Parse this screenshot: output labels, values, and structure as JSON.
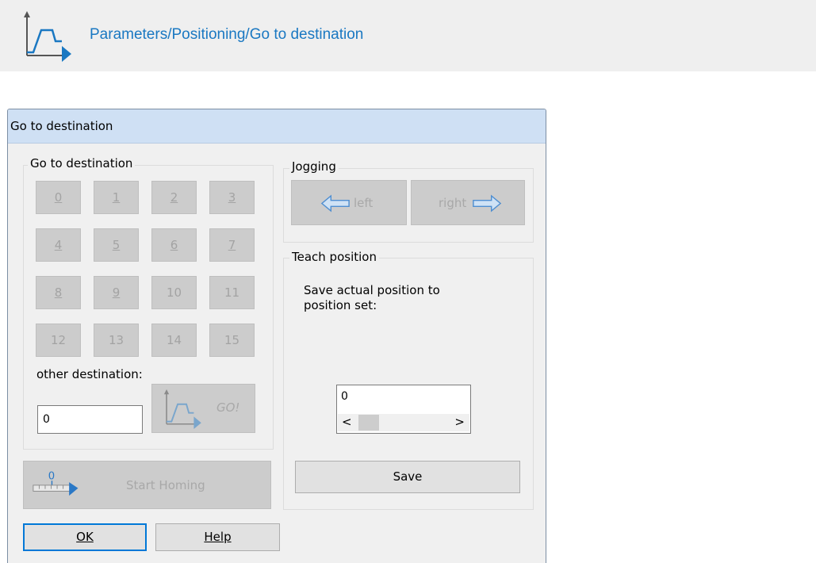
{
  "header": {
    "title": "Parameters/Positioning/Go to destination"
  },
  "dialog": {
    "title": "Go to destination",
    "goto_group": {
      "label": "Go to destination",
      "buttons": [
        "0",
        "1",
        "2",
        "3",
        "4",
        "5",
        "6",
        "7",
        "8",
        "9",
        "10",
        "11",
        "12",
        "13",
        "14",
        "15"
      ],
      "other_label": "other destination:",
      "other_value": "0",
      "go_label": "GO!"
    },
    "homing_label": "Start Homing",
    "jogging": {
      "label": "Jogging",
      "left": "left",
      "right": "right"
    },
    "teach": {
      "label": "Teach position",
      "description": "Save actual position to position set:",
      "value": "0",
      "save": "Save"
    },
    "ok": "OK",
    "help": "Help"
  },
  "colors": {
    "accent": "#1a78c2",
    "focus": "#0078d7",
    "titlebar": "#cfe0f4"
  }
}
